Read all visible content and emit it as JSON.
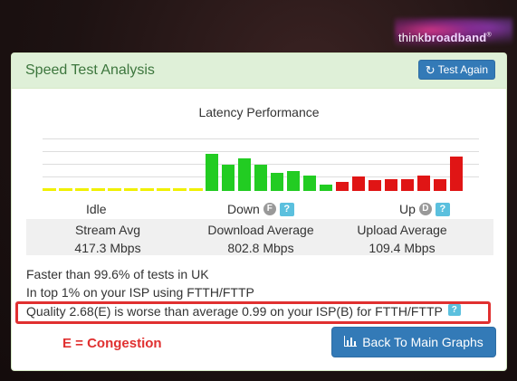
{
  "logo": {
    "text_light": "think",
    "text_bold": "broadband",
    "mark": "®"
  },
  "panel": {
    "title": "Speed Test Analysis",
    "test_again_label": "Test Again",
    "test_again_icon": "refresh-icon"
  },
  "latency": {
    "title": "Latency Performance",
    "phases": {
      "idle": {
        "label": "Idle"
      },
      "down": {
        "label": "Down",
        "grade": "F",
        "help": "?"
      },
      "up": {
        "label": "Up",
        "grade": "D",
        "help": "?"
      }
    }
  },
  "chart_data": {
    "type": "bar",
    "title": "Latency Performance",
    "ylim": [
      0,
      1
    ],
    "grid": true,
    "groups": [
      {
        "name": "Idle",
        "color": "#f0f000",
        "values": [
          0.06,
          0.06,
          0.06,
          0.06,
          0.06,
          0.06,
          0.06,
          0.06,
          0.06,
          0.06
        ]
      },
      {
        "name": "Down",
        "color": "#22cc22",
        "values": [
          0.7,
          0.5,
          0.62,
          0.5,
          0.35,
          0.38,
          0.3,
          0.12
        ]
      },
      {
        "name": "Up",
        "color": "#e01515",
        "values": [
          0.18,
          0.28,
          0.2,
          0.22,
          0.22,
          0.3,
          0.22,
          0.65
        ]
      }
    ]
  },
  "stats": {
    "stream": {
      "label": "Stream Avg",
      "value": "417.3 Mbps"
    },
    "download": {
      "label": "Download Average",
      "value": "802.8 Mbps"
    },
    "upload": {
      "label": "Upload Average",
      "value": "109.4 Mbps"
    }
  },
  "info": {
    "line1": "Faster than 99.6% of tests in UK",
    "line2": "In top 1% on your ISP using FTTH/FTTP",
    "quality": "Quality 2.68(E) is worse than average 0.99 on your ISP(B) for FTTH/FTTP",
    "quality_help": "?"
  },
  "annotation": {
    "congestion": "E = Congestion"
  },
  "back_button": {
    "label": "Back To Main Graphs",
    "icon": "bar-chart-icon"
  }
}
